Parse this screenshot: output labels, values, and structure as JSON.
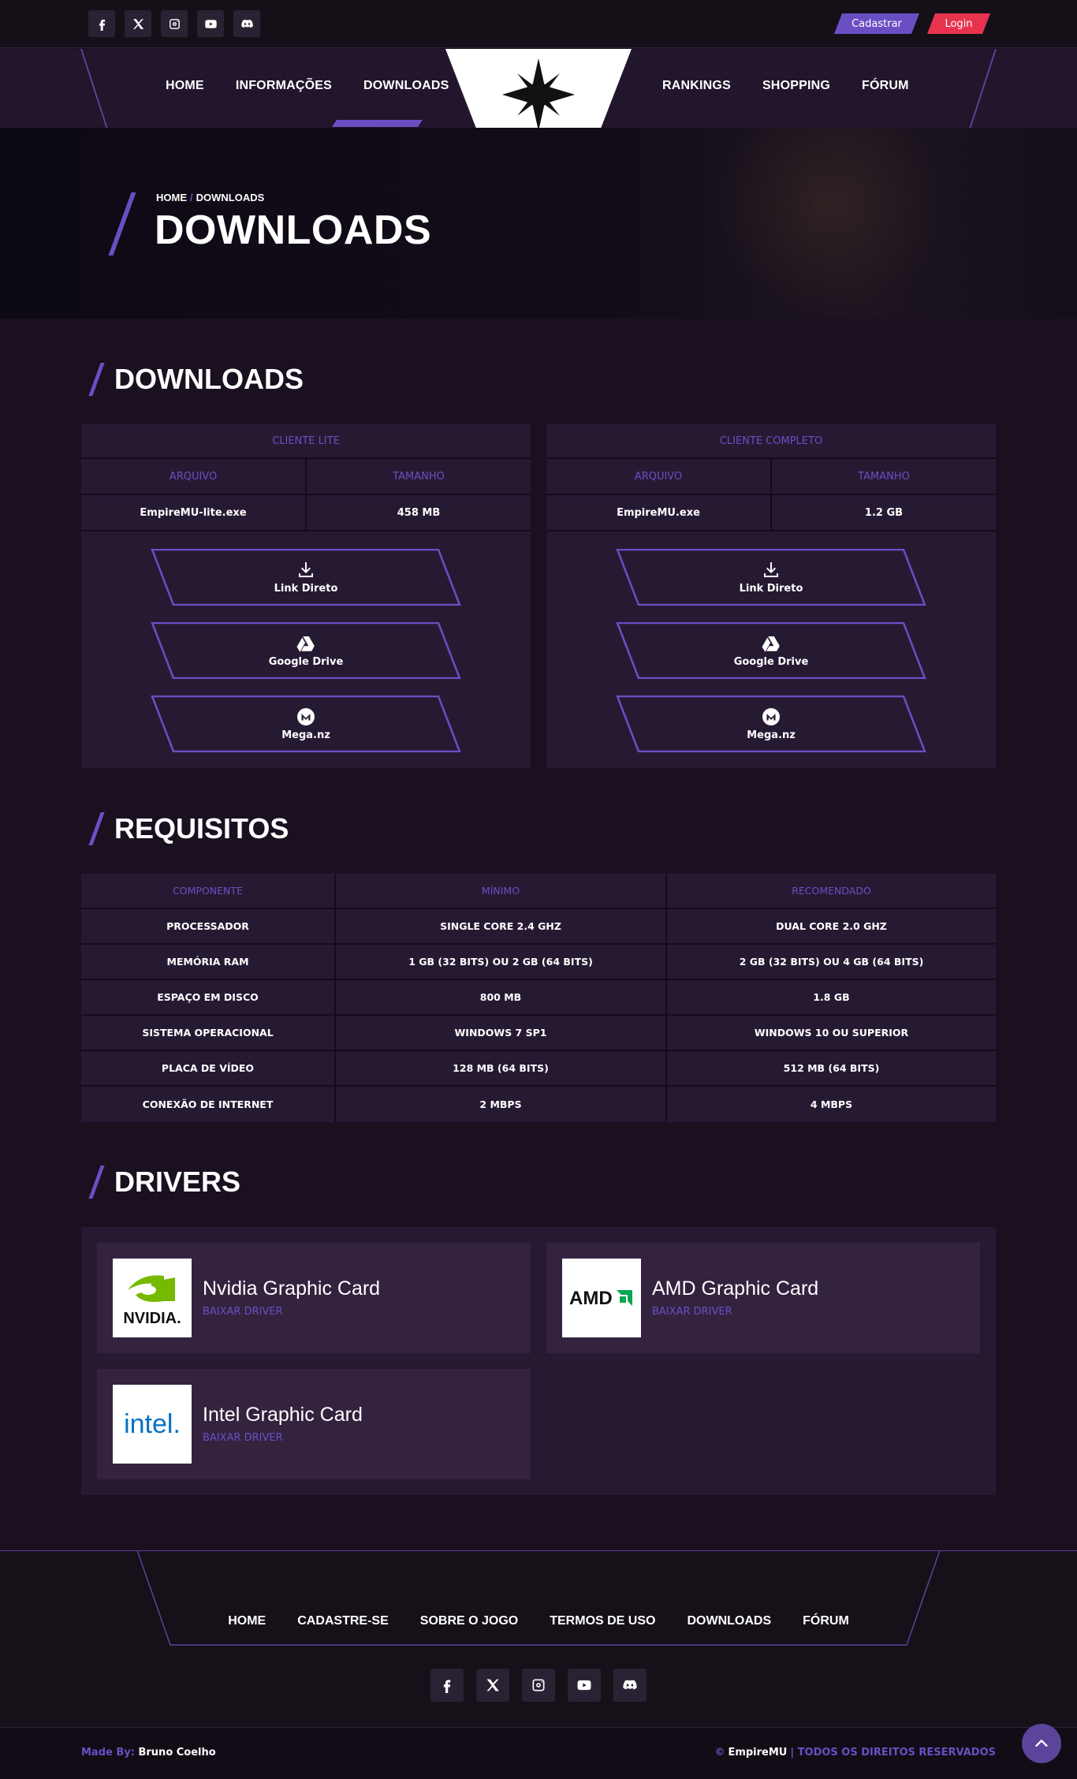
{
  "colors": {
    "accent": "#6a4fc4",
    "danger": "#e8334f",
    "panel": "#261a33",
    "bg": "#1a1020"
  },
  "topbar": {
    "socials": [
      "facebook-icon",
      "x-icon",
      "instagram-icon",
      "youtube-icon",
      "discord-icon"
    ],
    "register_label": "Cadastrar",
    "login_label": "Login"
  },
  "nav": {
    "left": [
      "HOME",
      "INFORMAÇÕES",
      "DOWNLOADS"
    ],
    "right": [
      "RANKINGS",
      "SHOPPING",
      "FÓRUM"
    ],
    "active": "DOWNLOADS",
    "logo_icon": "compass-star-icon"
  },
  "hero": {
    "breadcrumb_home": "HOME",
    "breadcrumb_sep": "/",
    "breadcrumb_current": "DOWNLOADS",
    "title": "DOWNLOADS"
  },
  "downloads": {
    "heading": "DOWNLOADS",
    "cards": [
      {
        "title": "CLIENTE LITE",
        "col_file": "ARQUIVO",
        "col_size": "TAMANHO",
        "file": "EmpireMU-lite.exe",
        "size": "458 MB",
        "buttons": [
          {
            "label": "Link Direto",
            "icon": "download-icon"
          },
          {
            "label": "Google Drive",
            "icon": "google-drive-icon"
          },
          {
            "label": "Mega.nz",
            "icon": "mega-icon"
          }
        ]
      },
      {
        "title": "CLIENTE COMPLETO",
        "col_file": "ARQUIVO",
        "col_size": "TAMANHO",
        "file": "EmpireMU.exe",
        "size": "1.2 GB",
        "buttons": [
          {
            "label": "Link Direto",
            "icon": "download-icon"
          },
          {
            "label": "Google Drive",
            "icon": "google-drive-icon"
          },
          {
            "label": "Mega.nz",
            "icon": "mega-icon"
          }
        ]
      }
    ]
  },
  "requirements": {
    "heading": "REQUISITOS",
    "headers": [
      "COMPONENTE",
      "MÍNIMO",
      "RECOMENDADO"
    ],
    "rows": [
      [
        "PROCESSADOR",
        "SINGLE CORE 2.4 GHZ",
        "DUAL CORE 2.0 GHZ"
      ],
      [
        "MEMÓRIA RAM",
        "1 GB (32 BITS) OU 2 GB (64 BITS)",
        "2 GB (32 BITS) OU 4 GB (64 BITS)"
      ],
      [
        "ESPAÇO EM DISCO",
        "800 MB",
        "1.8 GB"
      ],
      [
        "SISTEMA OPERACIONAL",
        "WINDOWS 7 SP1",
        "WINDOWS 10 OU SUPERIOR"
      ],
      [
        "PLACA DE VÍDEO",
        "128 MB (64 BITS)",
        "512 MB (64 BITS)"
      ],
      [
        "CONEXÃO DE INTERNET",
        "2 MBPS",
        "4 MBPS"
      ]
    ]
  },
  "drivers": {
    "heading": "DRIVERS",
    "items": [
      {
        "name": "Nvidia Graphic Card",
        "action": "BAIXAR DRIVER",
        "logo_text": "NVIDIA."
      },
      {
        "name": "AMD Graphic Card",
        "action": "BAIXAR DRIVER",
        "logo_text": "AMD"
      },
      {
        "name": "Intel Graphic Card",
        "action": "BAIXAR DRIVER",
        "logo_text": "intel."
      }
    ]
  },
  "footer": {
    "links": [
      "HOME",
      "CADASTRE-SE",
      "SOBRE O JOGO",
      "TERMOS DE USO",
      "DOWNLOADS",
      "FÓRUM"
    ],
    "made_by_label": "Made By:",
    "made_by_name": "Bruno Coelho",
    "brand": "EmpireMU",
    "rights": "| TODOS OS DIREITOS RESERVADOS",
    "copyright_icon": "©"
  }
}
